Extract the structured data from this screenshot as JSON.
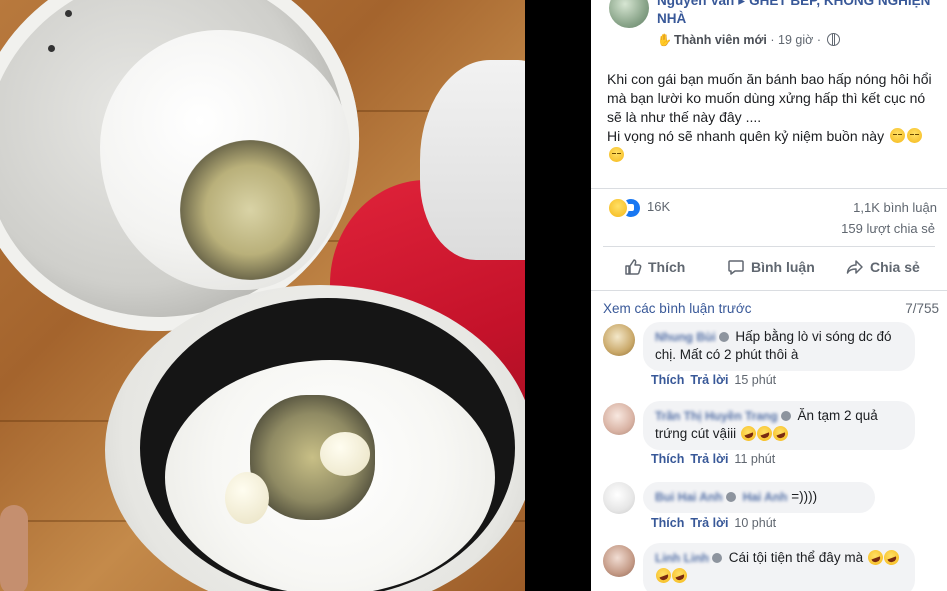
{
  "post": {
    "author": "Nguyen Van",
    "separator": "▸",
    "group": "GHÉT BẾP, KHÔNG NGHIỆN NHÀ",
    "badge": "Thành viên mới",
    "dot": "·",
    "time": "19 giờ",
    "body_line1": "Khi con gái bạn muốn ăn bánh bao hấp nóng hôi hổi mà bạn lười ko muốn dùng xửng hấp thì kết cục nó sẽ là như thế này đây ....",
    "body_line2": "Hi vọng nó sẽ nhanh quên kỷ niệm buồn này"
  },
  "stats": {
    "reactions": "16K",
    "comments": "1,1K bình luận",
    "shares": "159 lượt chia sẻ"
  },
  "actions": {
    "like": "Thích",
    "comment": "Bình luận",
    "share": "Chia sẻ"
  },
  "comments_header": {
    "view_previous": "Xem các bình luận trước",
    "count": "7/755"
  },
  "comments": [
    {
      "name": "Nhung Bùi",
      "text": "Hấp bằng lò vi sóng dc đó chị. Mất có 2 phút thôi à",
      "like": "Thích",
      "reply": "Trả lời",
      "time": "15 phút"
    },
    {
      "name": "Trần Thị Huyền Trang",
      "text": "Ăn tạm 2 quả trứng cút vậiii",
      "like": "Thích",
      "reply": "Trả lời",
      "time": "11 phút"
    },
    {
      "name": "Bui Hai Anh",
      "tagged": "Hai Anh",
      "text": "=))))",
      "like": "Thích",
      "reply": "Trả lời",
      "time": "10 phút"
    },
    {
      "name": "Linh Linh",
      "text": "Cái tội tiện thể đây mà"
    }
  ],
  "icons": {
    "like": "thumbs-up-icon",
    "comment": "speech-bubble-icon",
    "share": "share-arrow-icon",
    "privacy": "globe-icon",
    "member": "wave-hand-icon"
  },
  "colors": {
    "link": "#385898",
    "meta": "#606770",
    "bubble": "#f2f3f5",
    "like_blue": "#1877f2"
  }
}
